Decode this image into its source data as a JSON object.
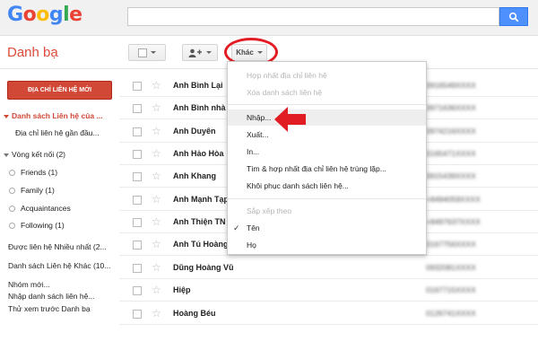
{
  "logo": {
    "text": "Google",
    "letters": [
      "G",
      "o",
      "o",
      "g",
      "l",
      "e"
    ],
    "colors": [
      "#4285f4",
      "#ea4335",
      "#fbbc05",
      "#4285f4",
      "#34a853",
      "#ea4335"
    ]
  },
  "search": {
    "value": "",
    "placeholder": ""
  },
  "app": {
    "title": "Danh bạ"
  },
  "toolbar": {
    "more_label": "Khác"
  },
  "sidebar": {
    "new_contact": "ĐỊA CHỈ LIÊN HỆ MỚI",
    "items": [
      {
        "label": "Danh sách Liên hệ của ...",
        "kind": "group-active"
      },
      {
        "label": "Địa chỉ liên hệ gần đầu...",
        "kind": "child"
      },
      {
        "label": "Vòng kết nối (2)",
        "kind": "group"
      },
      {
        "label": "Friends (1)",
        "kind": "circle"
      },
      {
        "label": "Family (1)",
        "kind": "circle"
      },
      {
        "label": "Acquaintances",
        "kind": "circle"
      },
      {
        "label": "Following (1)",
        "kind": "circle"
      },
      {
        "label": "Được liên hệ Nhiều nhất (2...",
        "kind": "plain"
      },
      {
        "label": "Danh sách Liên hệ Khác (10...",
        "kind": "plain"
      },
      {
        "label": "Nhóm mới...",
        "kind": "plain"
      },
      {
        "label": "Nhập danh sách liên hệ...",
        "kind": "plain"
      },
      {
        "label": "Thử xem trước Danh bạ",
        "kind": "plain"
      }
    ]
  },
  "contacts": [
    {
      "name": "Anh Bình Lại",
      "phone": "0916549XXXX"
    },
    {
      "name": "Anh Bình nhà",
      "phone": "0971636XXXX"
    },
    {
      "name": "Anh Duyên",
      "phone": "0974216XXXX"
    },
    {
      "name": "Anh Hảo Hòa",
      "phone": "0165471XXXX"
    },
    {
      "name": "Anh Khang",
      "phone": "0915439XXXX"
    },
    {
      "name": "Anh Mạnh Tạp",
      "phone": "+8494059XXXX"
    },
    {
      "name": "Anh Thiện TN",
      "phone": "+8497637XXXX"
    },
    {
      "name": "Anh Tú Hoàng",
      "phone": "0167756XXXX"
    },
    {
      "name": "Dũng Hoàng Vũ",
      "phone": "0932081XXXX"
    },
    {
      "name": "Hiệp",
      "phone": "0167715XXXX"
    },
    {
      "name": "Hoàng Béu",
      "phone": "0126741XXXX"
    }
  ],
  "menu": {
    "items": [
      {
        "label": "Hợp nhất địa chỉ liên hệ",
        "disabled": true
      },
      {
        "label": "Xóa danh sách liên hệ",
        "disabled": true
      },
      {
        "label": "Nhập...",
        "highlighted": true
      },
      {
        "label": "Xuất..."
      },
      {
        "label": "In..."
      },
      {
        "label": "Tìm & hợp nhất địa chỉ liên hệ trùng lặp..."
      },
      {
        "label": "Khôi phục danh sách liên hệ..."
      },
      {
        "label": "Sắp xếp theo",
        "disabled": true
      },
      {
        "label": "Tên",
        "checked": true
      },
      {
        "label": "Họ"
      }
    ]
  },
  "colors": {
    "accent": "#dd4b39",
    "annotation": "#e21c23",
    "search_blue": "#4d90fe"
  }
}
